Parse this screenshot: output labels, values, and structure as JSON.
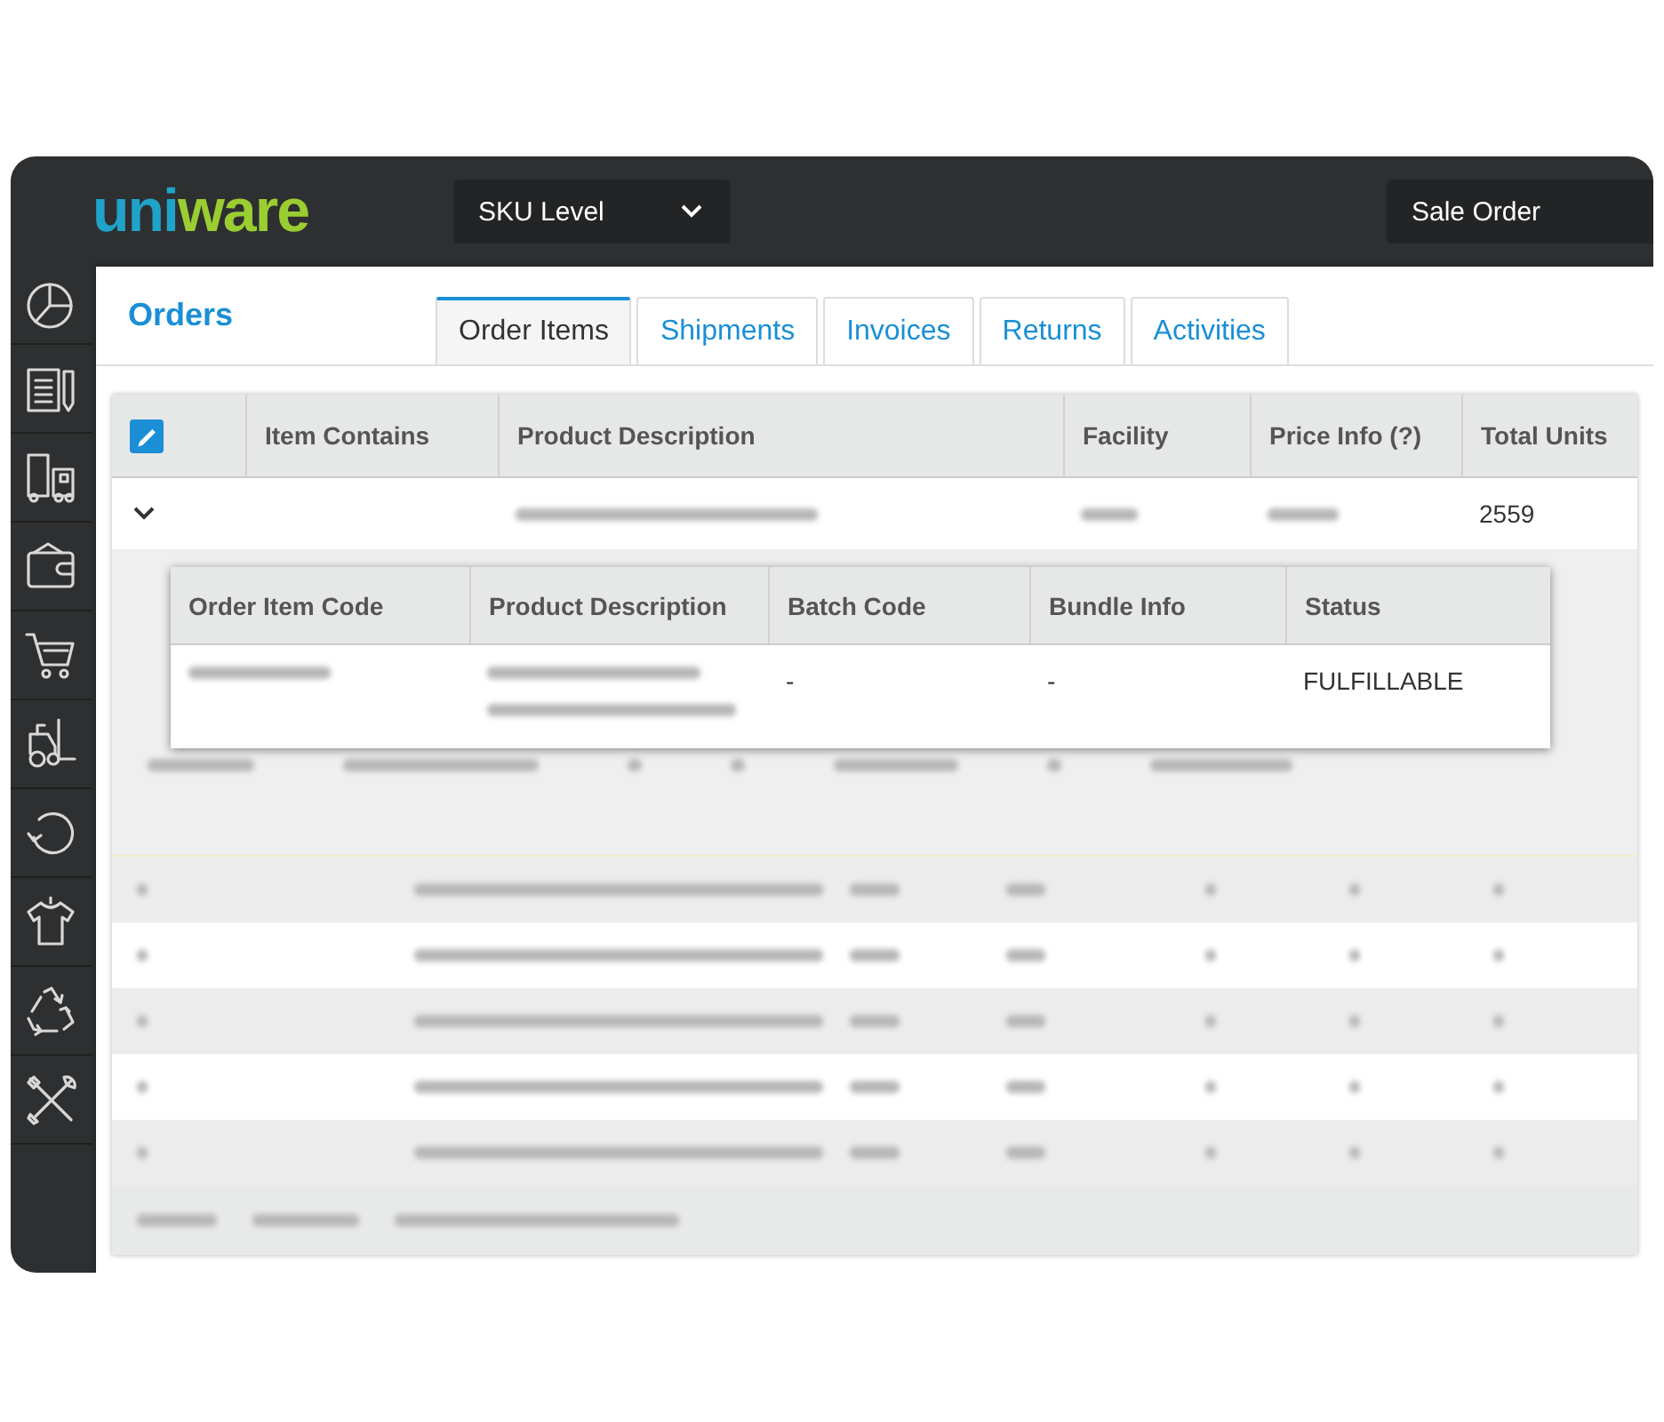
{
  "logo": {
    "text": "uniware"
  },
  "top_bar": {
    "level_dropdown": {
      "value": "SKU Level"
    },
    "search_type": {
      "value": "Sale Order"
    }
  },
  "page": {
    "title": "Orders"
  },
  "tabs": [
    {
      "label": "Order Items",
      "selected": true
    },
    {
      "label": "Shipments",
      "selected": false
    },
    {
      "label": "Invoices",
      "selected": false
    },
    {
      "label": "Returns",
      "selected": false
    },
    {
      "label": "Activities",
      "selected": false
    }
  ],
  "table": {
    "select_all": {
      "checked": true
    },
    "columns": [
      "Item Contains",
      "Product Description",
      "Facility",
      "Price Info (?)",
      "Total Units"
    ],
    "rows": [
      {
        "expanded": true,
        "total_units": "2559"
      }
    ]
  },
  "item_popup": {
    "columns": [
      "Order Item Code",
      "Product Description",
      "Batch Code",
      "Bundle Info",
      "Status"
    ],
    "rows": [
      {
        "batch_code": "-",
        "bundle_info": "-",
        "status": "FULFILLABLE"
      }
    ]
  }
}
